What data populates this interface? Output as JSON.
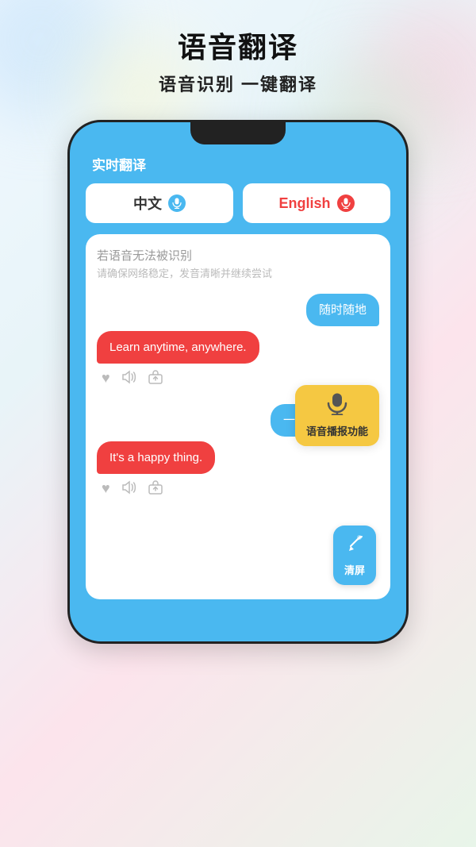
{
  "header": {
    "main_title": "语音翻译",
    "sub_title": "语音识别 一键翻译"
  },
  "phone": {
    "app_title": "实时翻译",
    "lang_left": {
      "label": "中文",
      "mic_type": "blue"
    },
    "lang_right": {
      "label": "English",
      "mic_type": "red"
    },
    "error_title": "若语音无法被识别",
    "error_sub": "请确保网络稳定，发音清晰并继续尝试",
    "chat_groups": [
      {
        "right_bubble": "随时随地",
        "left_bubble": "Learn anytime, anywhere."
      },
      {
        "right_bubble": "一件快乐的事。",
        "left_bubble": "It's a happy thing."
      }
    ],
    "tooltip": {
      "icon": "🎤",
      "label": "语音播报功能"
    },
    "clear_btn": {
      "icon": "🧹",
      "label": "清屏"
    }
  }
}
